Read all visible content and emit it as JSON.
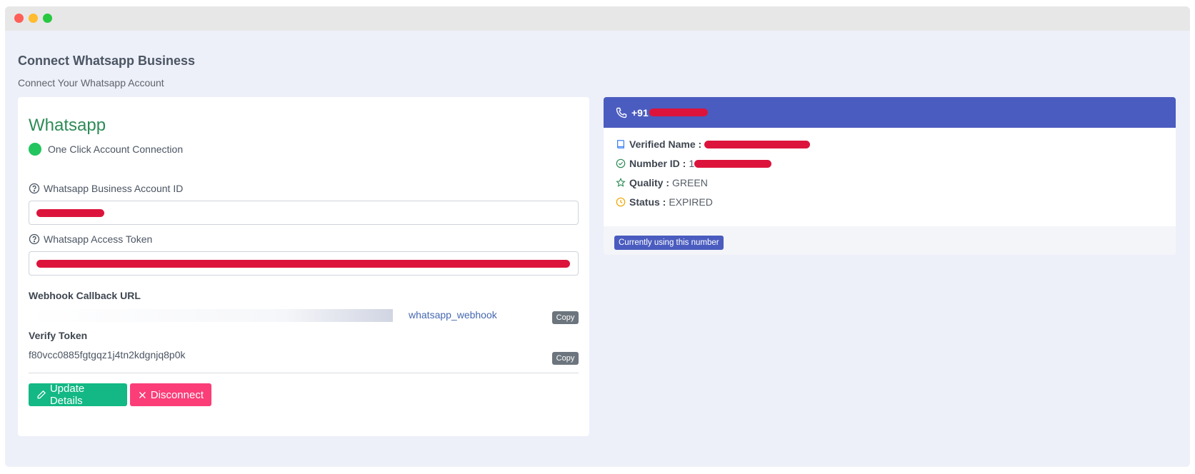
{
  "page": {
    "title": "Connect Whatsapp Business",
    "subtitle": "Connect Your Whatsapp Account"
  },
  "whatsapp_card": {
    "title": "Whatsapp",
    "status_text": "One Click Account Connection",
    "account_id_label": "Whatsapp Business Account ID",
    "account_id_value": "",
    "access_token_label": "Whatsapp Access Token",
    "access_token_value": "",
    "webhook_label": "Webhook Callback URL",
    "webhook_url_suffix": "whatsapp_webhook",
    "verify_token_label": "Verify Token",
    "verify_token_value": "f80vcc0885fgtgqz1j4tn2kdgnjq8p0k",
    "copy_label": "Copy",
    "update_button": "Update Details",
    "disconnect_button": "Disconnect",
    "status_color": "#22c55e"
  },
  "number_card": {
    "phone_prefix": "+91",
    "verified_name_label": "Verified Name :",
    "number_id_label": "Number ID :",
    "number_id_prefix": "1",
    "quality_label": "Quality :",
    "quality_value": "GREEN",
    "status_label": "Status :",
    "status_value": "EXPIRED",
    "badge": "Currently using this number",
    "header_color": "#4a5cbf"
  },
  "icons": [
    "question-circle-icon",
    "phone-icon",
    "book-icon",
    "check-circle-icon",
    "star-icon",
    "clock-icon",
    "pencil-icon",
    "x-icon"
  ]
}
